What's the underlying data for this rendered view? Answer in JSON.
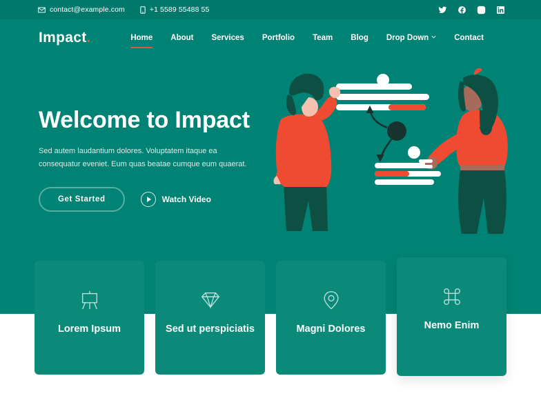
{
  "colors": {
    "hero_bg": "#008374",
    "topbar_bg": "#00796b",
    "card_bg": "#0b8a79",
    "accent": "#e8543f",
    "text_light": "#d9eeea",
    "white": "#ffffff"
  },
  "topbar": {
    "email": "contact@example.com",
    "phone": "+1 5589 55488 55",
    "email_icon": "envelope-icon",
    "phone_icon": "phone-icon",
    "socials": [
      {
        "name": "twitter-icon",
        "label": "Twitter"
      },
      {
        "name": "facebook-icon",
        "label": "Facebook"
      },
      {
        "name": "instagram-icon",
        "label": "Instagram"
      },
      {
        "name": "linkedin-icon",
        "label": "LinkedIn"
      }
    ]
  },
  "header": {
    "logo_text": "Impact",
    "logo_dot": ".",
    "nav": [
      {
        "label": "Home",
        "active": true
      },
      {
        "label": "About",
        "active": false
      },
      {
        "label": "Services",
        "active": false
      },
      {
        "label": "Portfolio",
        "active": false
      },
      {
        "label": "Team",
        "active": false
      },
      {
        "label": "Blog",
        "active": false
      },
      {
        "label": "Drop Down",
        "active": false,
        "has_caret": true
      },
      {
        "label": "Contact",
        "active": false
      }
    ]
  },
  "hero": {
    "title": "Welcome to Impact",
    "subtitle": "Sed autem laudantium dolores. Voluptatem itaque ea consequatur eveniet. Eum quas beatae cumque eum quaerat.",
    "primary_button": "Get Started",
    "secondary_button": "Watch Video",
    "illustration_alt": "two-people-with-charts-illustration"
  },
  "cards": [
    {
      "icon": "easel-icon",
      "title": "Lorem Ipsum"
    },
    {
      "icon": "gem-icon",
      "title": "Sed ut perspiciatis"
    },
    {
      "icon": "map-pin-icon",
      "title": "Magni Dolores"
    },
    {
      "icon": "command-icon",
      "title": "Nemo Enim"
    }
  ]
}
